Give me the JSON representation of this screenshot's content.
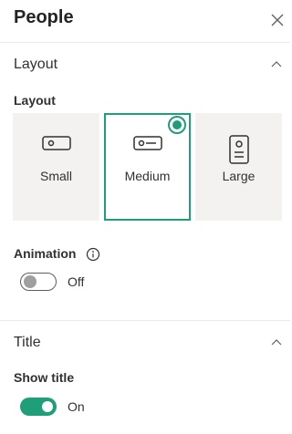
{
  "panel": {
    "title": "People",
    "close_icon": "close-icon"
  },
  "layout_section": {
    "title": "Layout",
    "expanded": true,
    "field_label": "Layout",
    "options": [
      {
        "label": "Small",
        "icon": "person-card-small-icon",
        "selected": false
      },
      {
        "label": "Medium",
        "icon": "person-card-medium-icon",
        "selected": true
      },
      {
        "label": "Large",
        "icon": "person-card-large-icon",
        "selected": false
      }
    ],
    "animation": {
      "label": "Animation",
      "info_icon": "info-icon",
      "state": false,
      "state_text": "Off"
    }
  },
  "title_section": {
    "title": "Title",
    "expanded": true,
    "show_title": {
      "label": "Show title",
      "state": true,
      "state_text": "On"
    }
  },
  "colors": {
    "accent": "#1f9e7a",
    "option_bg": "#f3f2f1",
    "divider": "#edebe9",
    "text": "#323130"
  }
}
